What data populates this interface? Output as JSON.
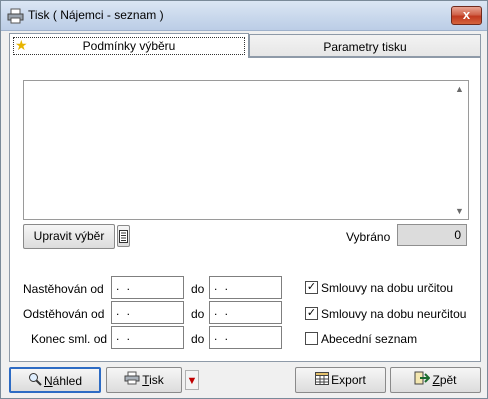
{
  "window": {
    "title": "Tisk ( Nájemci - seznam )",
    "close_symbol": "x"
  },
  "tabs": [
    {
      "label": "Podmínky výběru",
      "active": true,
      "icon": "star-icon"
    },
    {
      "label": "Parametry tisku",
      "active": false
    }
  ],
  "selection": {
    "edit_button_label": "Upravit výběr",
    "count_label": "Vybráno",
    "count_value": "0",
    "memo_scroll_up": "▲",
    "memo_scroll_down": "▼"
  },
  "filters": [
    {
      "label": "Nastěhován od",
      "from": ". .",
      "to_label": "do",
      "to": ". ."
    },
    {
      "label": "Odstěhován od",
      "from": ". .",
      "to_label": "do",
      "to": ". ."
    },
    {
      "label": "Konec sml. od",
      "from": ". .",
      "to_label": "do",
      "to": ". ."
    }
  ],
  "checkboxes": [
    {
      "label": "Smlouvy na dobu určitou",
      "checked": true,
      "mark": "✓"
    },
    {
      "label": "Smlouvy na dobu neurčitou",
      "checked": true,
      "mark": "✓"
    },
    {
      "label": "Abecední seznam",
      "checked": false,
      "mark": ""
    }
  ],
  "footer": {
    "preview_label_first": "N",
    "preview_label_rest": "áhled",
    "print_label_first": "T",
    "print_label_rest": "isk",
    "print_dropdown_symbol": "▼",
    "export_label": "Export",
    "back_label_first": "Z",
    "back_label_rest": "pět"
  },
  "colors": {
    "accent_focus": "#2d6bc4",
    "close_red": "#c1391f"
  }
}
